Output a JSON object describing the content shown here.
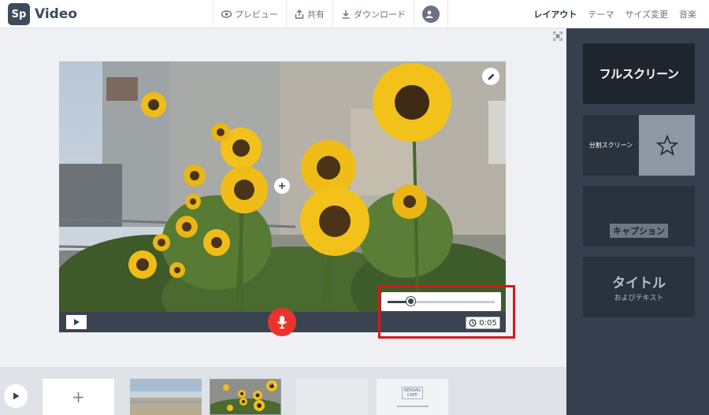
{
  "app": {
    "logo_badge": "Sp",
    "title": "Video"
  },
  "toolbar": {
    "preview": "プレビュー",
    "share": "共有",
    "download": "ダウンロード",
    "avatar_icon": "user-icon"
  },
  "tabs": [
    "レイアウト",
    "テーマ",
    "サイズ変更",
    "音楽"
  ],
  "layouts": {
    "fullscreen": "フルスクリーン",
    "split": "分割スクリーン",
    "caption": "キャプション",
    "title": "タイトル",
    "title_sub": "およびテキスト"
  },
  "player": {
    "duration": "0:05",
    "slider_fraction": 0.22
  },
  "timeline": {
    "add_label": "+",
    "clip_logo": "NEKNAG\nCAFE",
    "clip_menu": "···"
  },
  "colors": {
    "accent_dark": "#353f4d",
    "record_red": "#e8342c",
    "highlight_red": "#d41a1a"
  }
}
